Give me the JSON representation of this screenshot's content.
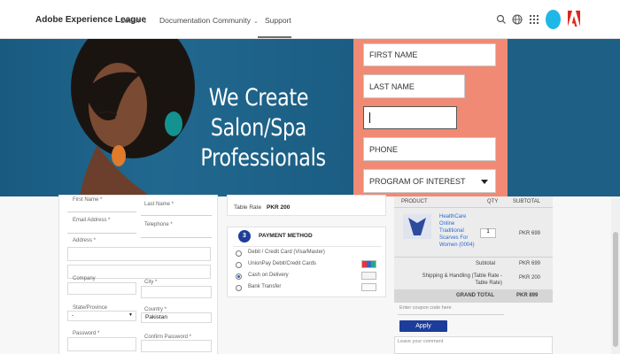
{
  "header": {
    "brand": "Adobe Experience League",
    "nav": [
      {
        "label": "Learn",
        "has_menu": true
      },
      {
        "label": "Documentation",
        "has_menu": false
      },
      {
        "label": "Community",
        "has_menu": true
      },
      {
        "label": "Support",
        "has_menu": false
      }
    ]
  },
  "hero": {
    "lines": [
      "We Create",
      "Salon/Spa",
      "Professionals"
    ],
    "form": {
      "first_name": "FIRST NAME",
      "last_name": "LAST NAME",
      "phone": "PHONE",
      "program": "PROGRAM OF INTEREST"
    },
    "colors": {
      "panel": "#f08a74",
      "banner": "#1e5f85"
    }
  },
  "billing": {
    "first_name": "First Name *",
    "last_name": "Last Name *",
    "email": "Email Address *",
    "telephone": "Telephone *",
    "address": "Address *",
    "company": "Company",
    "city": "City *",
    "state": "State/Province",
    "state_value": "-",
    "country": "Country *",
    "country_value": "Pakistan",
    "password": "Password *",
    "confirm_password": "Confirm Password *"
  },
  "shipping": {
    "rate_label": "Table Rate",
    "rate_value": "PKR 200"
  },
  "payment": {
    "step": "3",
    "title": "PAYMENT METHOD",
    "options": [
      {
        "label": "Debit / Credit Card (Visa/Master)",
        "selected": false
      },
      {
        "label": "UnionPay Debit/Credit Cards",
        "selected": false
      },
      {
        "label": "Cash on Delivery",
        "selected": true
      },
      {
        "label": "Bank Transfer",
        "selected": false
      }
    ]
  },
  "cart": {
    "headers": [
      "PRODUCT",
      "QTY",
      "SUBTOTAL"
    ],
    "item": {
      "name": "HealthCare Online Traditional Scarves For Women (0004)",
      "qty": "1",
      "price": "PKR 699"
    },
    "subtotal_label": "Subtotal",
    "subtotal": "PKR 699",
    "shipping_label": "Shipping & Handling (Table Rate - Table Rate)",
    "shipping": "PKR 200",
    "grand_label": "GRAND TOTAL",
    "grand": "PKR 899",
    "coupon_placeholder": "Enter coupon code here",
    "apply": "Apply",
    "comment_placeholder": "Leave your comment"
  }
}
